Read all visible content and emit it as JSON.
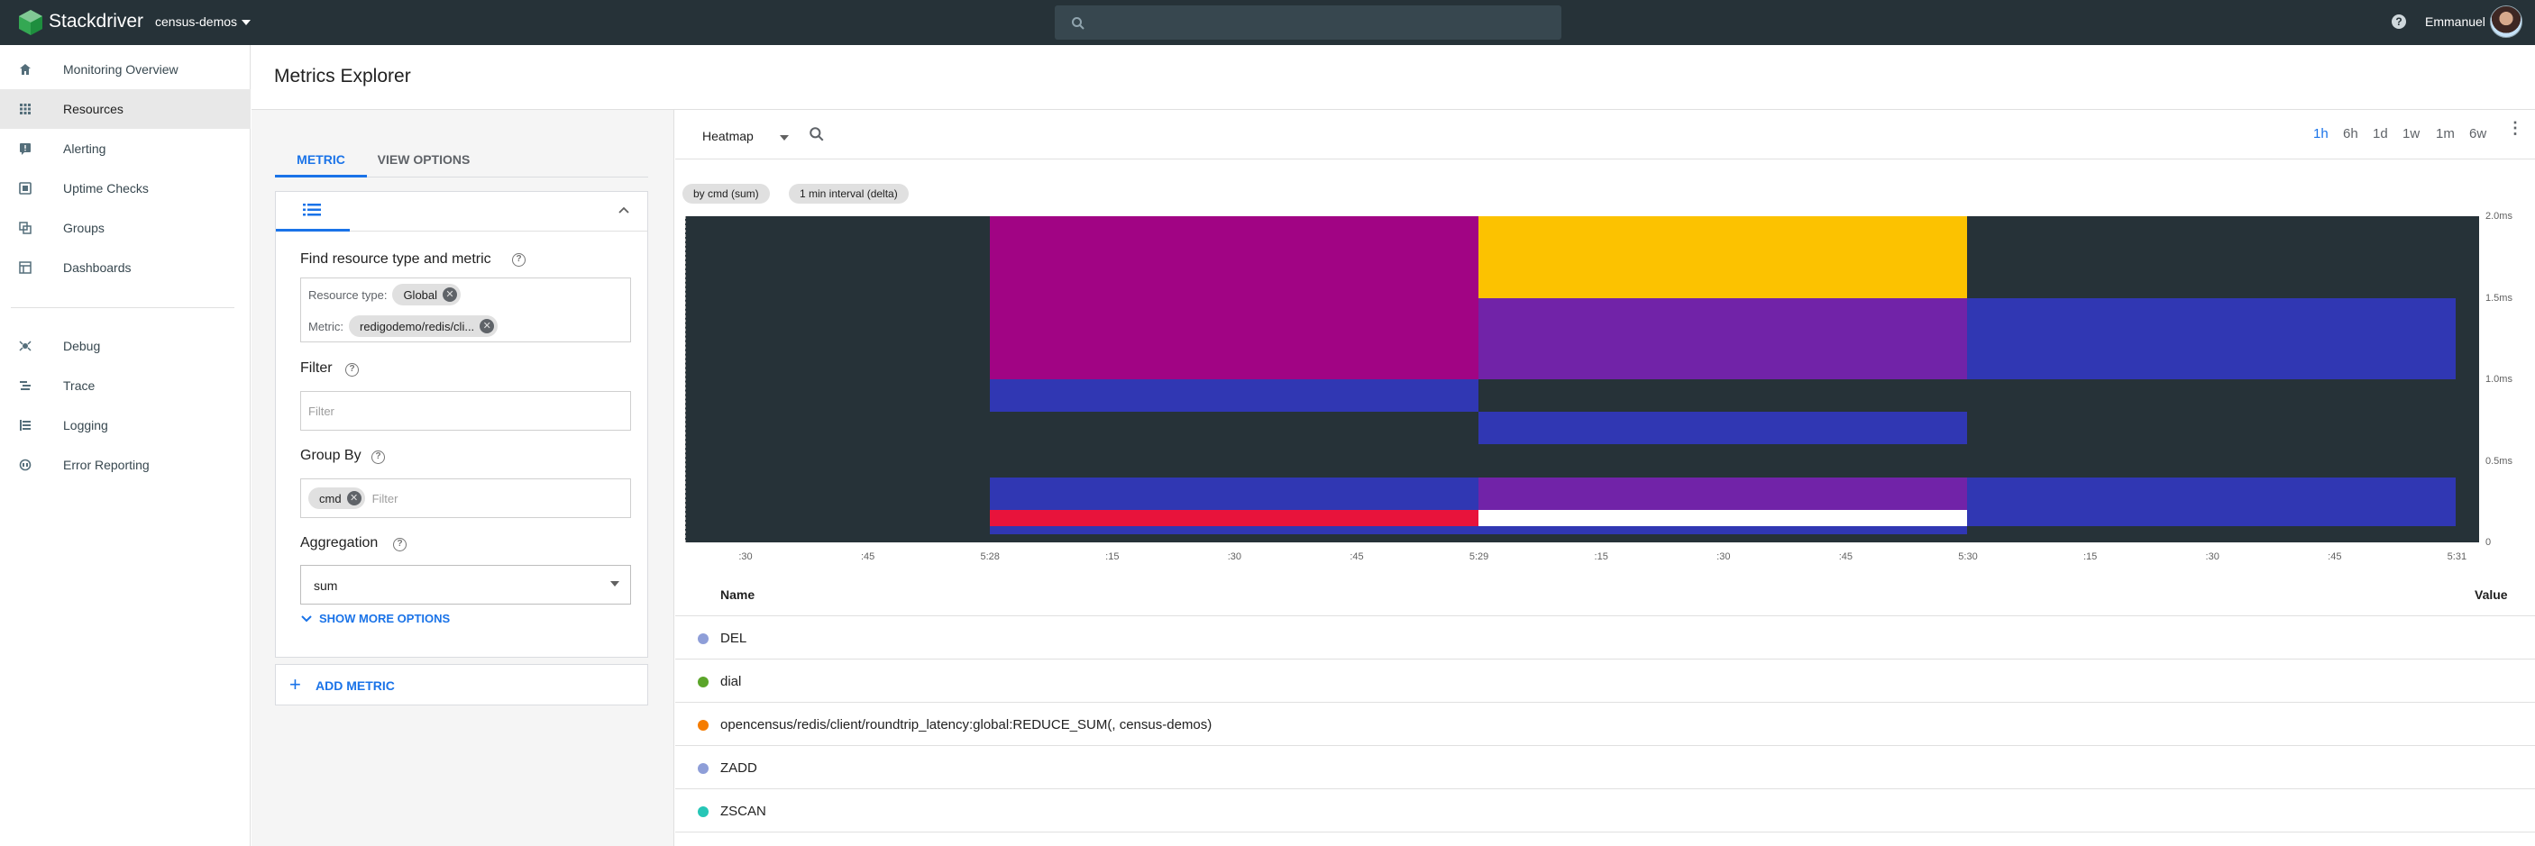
{
  "topbar": {
    "brand": "Stackdriver",
    "project": "census-demos",
    "user": "Emmanuel",
    "help_icon_text": "?"
  },
  "sidebar": {
    "items": [
      {
        "label": "Monitoring Overview",
        "icon": "home-icon"
      },
      {
        "label": "Resources",
        "icon": "grid-icon",
        "active": true
      },
      {
        "label": "Alerting",
        "icon": "alert-icon"
      },
      {
        "label": "Uptime Checks",
        "icon": "uptime-icon"
      },
      {
        "label": "Groups",
        "icon": "groups-icon"
      },
      {
        "label": "Dashboards",
        "icon": "dashboard-icon"
      },
      {
        "label": "Debug",
        "icon": "debug-icon"
      },
      {
        "label": "Trace",
        "icon": "trace-icon"
      },
      {
        "label": "Logging",
        "icon": "logging-icon"
      },
      {
        "label": "Error Reporting",
        "icon": "error-reporting-icon"
      }
    ]
  },
  "page": {
    "title": "Metrics Explorer"
  },
  "config": {
    "tabs": [
      {
        "label": "METRIC",
        "active": true
      },
      {
        "label": "VIEW OPTIONS",
        "active": false
      }
    ],
    "find_label": "Find resource type and metric",
    "resource_type_label": "Resource type:",
    "resource_type_value": "Global",
    "metric_label": "Metric:",
    "metric_value": "redigodemo/redis/cli...",
    "filter_label": "Filter",
    "filter_placeholder": "Filter",
    "group_by_label": "Group By",
    "group_by_chip": "cmd",
    "group_by_placeholder": "Filter",
    "aggregation_label": "Aggregation",
    "aggregation_value": "sum",
    "show_more": "SHOW MORE OPTIONS",
    "add_metric": "ADD METRIC"
  },
  "chart_toolbar": {
    "chart_type": "Heatmap",
    "ranges": [
      {
        "label": "1h",
        "active": true
      },
      {
        "label": "6h",
        "active": false
      },
      {
        "label": "1d",
        "active": false
      },
      {
        "label": "1w",
        "active": false
      },
      {
        "label": "1m",
        "active": false
      },
      {
        "label": "6w",
        "active": false
      }
    ],
    "pills": [
      "by cmd (sum)",
      "1 min interval (delta)"
    ]
  },
  "chart_data": {
    "type": "heatmap",
    "x_tick_labels": [
      ":30",
      ":45",
      "5:28",
      ":15",
      ":30",
      ":45",
      "5:29",
      ":15",
      ":30",
      ":45",
      "5:30",
      ":15",
      ":30",
      ":45",
      "5:31"
    ],
    "y_tick_labels": [
      "2.0ms",
      "1.5ms",
      "1.0ms",
      "0.5ms",
      "0"
    ],
    "y_range_ms": [
      0,
      2.0
    ],
    "background_color": "#263238",
    "columns": [
      {
        "label": "5:28",
        "buckets": [
          {
            "from_ms": 1.0,
            "to_ms": 2.0,
            "color": "#a10484"
          },
          {
            "from_ms": 0.8,
            "to_ms": 1.0,
            "color": "#3037b3"
          },
          {
            "from_ms": 0.2,
            "to_ms": 0.4,
            "color": "#3037b3"
          },
          {
            "from_ms": 0.1,
            "to_ms": 0.2,
            "color": "#e8133b"
          },
          {
            "from_ms": 0.05,
            "to_ms": 0.1,
            "color": "#3037b3"
          }
        ]
      },
      {
        "label": "5:29",
        "buckets": [
          {
            "from_ms": 1.5,
            "to_ms": 2.0,
            "color": "#fcc200"
          },
          {
            "from_ms": 1.0,
            "to_ms": 1.5,
            "color": "#7123a8"
          },
          {
            "from_ms": 0.6,
            "to_ms": 0.8,
            "color": "#3037b3"
          },
          {
            "from_ms": 0.2,
            "to_ms": 0.4,
            "color": "#7123a8"
          },
          {
            "from_ms": 0.1,
            "to_ms": 0.2,
            "color": "#ffffff"
          },
          {
            "from_ms": 0.05,
            "to_ms": 0.1,
            "color": "#3037b3"
          }
        ]
      },
      {
        "label": "5:30",
        "buckets": [
          {
            "from_ms": 1.0,
            "to_ms": 1.5,
            "color": "#3037b3"
          },
          {
            "from_ms": 0.1,
            "to_ms": 0.4,
            "color": "#3037b3"
          }
        ]
      }
    ]
  },
  "legend": {
    "header_name": "Name",
    "header_value": "Value",
    "rows": [
      {
        "name": "DEL",
        "color": "#8e9ed8"
      },
      {
        "name": "dial",
        "color": "#5ba52a"
      },
      {
        "name": "opencensus/redis/client/roundtrip_latency:global:REDUCE_SUM(, census-demos)",
        "color": "#f57c00"
      },
      {
        "name": "ZADD",
        "color": "#8e9ed8"
      },
      {
        "name": "ZSCAN",
        "color": "#26c6b6"
      }
    ]
  }
}
